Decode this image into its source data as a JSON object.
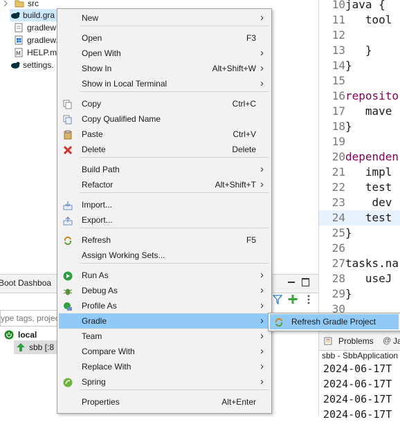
{
  "explorer": {
    "items": [
      {
        "label": "src",
        "icon": "folder-icon"
      },
      {
        "label": "build.gra",
        "icon": "gradle-elephant-icon"
      },
      {
        "label": "gradlew",
        "icon": "file-icon"
      },
      {
        "label": "gradlew.",
        "icon": "windows-file-icon"
      },
      {
        "label": "HELP.mc",
        "icon": "markdown-file-icon"
      },
      {
        "label": "settings.",
        "icon": "gradle-elephant-icon"
      }
    ]
  },
  "editor": {
    "lines": [
      {
        "num": "10",
        "code": "java {"
      },
      {
        "num": "11",
        "code": "   tool"
      },
      {
        "num": "12",
        "code": ""
      },
      {
        "num": "13",
        "code": "   }"
      },
      {
        "num": "14",
        "code": "}"
      },
      {
        "num": "15",
        "code": ""
      },
      {
        "num": "16",
        "code": "reposito"
      },
      {
        "num": "17",
        "code": "   mave"
      },
      {
        "num": "18",
        "code": "}"
      },
      {
        "num": "19",
        "code": ""
      },
      {
        "num": "20",
        "code": "dependen"
      },
      {
        "num": "21",
        "code": "   impl"
      },
      {
        "num": "22",
        "code": "   test"
      },
      {
        "num": "23",
        "code": "    dev"
      },
      {
        "num": "24",
        "code": "   test"
      },
      {
        "num": "25",
        "code": "}"
      },
      {
        "num": "26",
        "code": ""
      },
      {
        "num": "27",
        "code": "tasks.na"
      },
      {
        "num": "28",
        "code": "   useJ"
      },
      {
        "num": "29",
        "code": "}"
      },
      {
        "num": "30",
        "code": ""
      }
    ]
  },
  "dashboard": {
    "tab_label": "Boot Dashboa",
    "filter_placeholder": "ype tags, projec",
    "local_label": "local",
    "app_label": "sbb [:8"
  },
  "console": {
    "tab_problems": "Problems",
    "tab_javadoc": "Ja",
    "title": "sbb - SbbApplication",
    "lines": [
      "2024-06-17T",
      "2024-06-17T",
      "2024-06-17T",
      "2024-06-17T"
    ]
  },
  "context_menu": {
    "items": [
      {
        "label": "New",
        "shortcut": "",
        "submenu": true,
        "icon": ""
      },
      {
        "label": "Open",
        "shortcut": "F3",
        "submenu": false,
        "icon": ""
      },
      {
        "label": "Open With",
        "shortcut": "",
        "submenu": true,
        "icon": ""
      },
      {
        "label": "Show In",
        "shortcut": "Alt+Shift+W",
        "submenu": true,
        "icon": ""
      },
      {
        "label": "Show in Local Terminal",
        "shortcut": "",
        "submenu": true,
        "icon": ""
      },
      {
        "label": "Copy",
        "shortcut": "Ctrl+C",
        "submenu": false,
        "icon": "copy-icon"
      },
      {
        "label": "Copy Qualified Name",
        "shortcut": "",
        "submenu": false,
        "icon": "copy-qualified-icon"
      },
      {
        "label": "Paste",
        "shortcut": "Ctrl+V",
        "submenu": false,
        "icon": "paste-icon"
      },
      {
        "label": "Delete",
        "shortcut": "Delete",
        "submenu": false,
        "icon": "delete-icon"
      },
      {
        "label": "Build Path",
        "shortcut": "",
        "submenu": true,
        "icon": ""
      },
      {
        "label": "Refactor",
        "shortcut": "Alt+Shift+T",
        "submenu": true,
        "icon": ""
      },
      {
        "label": "Import...",
        "shortcut": "",
        "submenu": false,
        "icon": "import-icon"
      },
      {
        "label": "Export...",
        "shortcut": "",
        "submenu": false,
        "icon": "export-icon"
      },
      {
        "label": "Refresh",
        "shortcut": "F5",
        "submenu": false,
        "icon": "refresh-icon"
      },
      {
        "label": "Assign Working Sets...",
        "shortcut": "",
        "submenu": false,
        "icon": ""
      },
      {
        "label": "Run As",
        "shortcut": "",
        "submenu": true,
        "icon": "run-icon"
      },
      {
        "label": "Debug As",
        "shortcut": "",
        "submenu": true,
        "icon": "debug-icon"
      },
      {
        "label": "Profile As",
        "shortcut": "",
        "submenu": true,
        "icon": "profile-icon"
      },
      {
        "label": "Gradle",
        "shortcut": "",
        "submenu": true,
        "icon": ""
      },
      {
        "label": "Team",
        "shortcut": "",
        "submenu": true,
        "icon": ""
      },
      {
        "label": "Compare With",
        "shortcut": "",
        "submenu": true,
        "icon": ""
      },
      {
        "label": "Replace With",
        "shortcut": "",
        "submenu": true,
        "icon": ""
      },
      {
        "label": "Spring",
        "shortcut": "",
        "submenu": true,
        "icon": "spring-icon"
      },
      {
        "label": "Properties",
        "shortcut": "Alt+Enter",
        "submenu": false,
        "icon": ""
      }
    ]
  },
  "gradle_submenu": {
    "item_label": "Refresh Gradle Project",
    "icon": "gradle-refresh-icon"
  },
  "colors": {
    "menu_bg": "#f2f2f2",
    "menu_highlight": "#91c9f7",
    "keyword": "#7f0055",
    "selection": "#cde8ff"
  }
}
